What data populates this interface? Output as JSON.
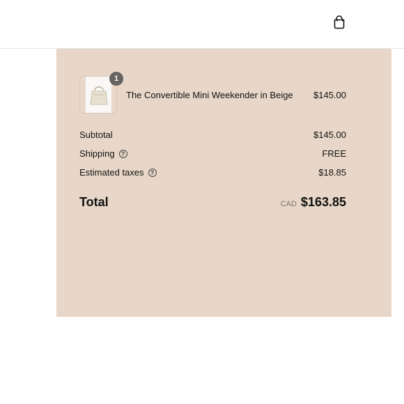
{
  "header": {
    "cart_icon": "shopping-bag-icon"
  },
  "order_summary": {
    "item": {
      "quantity": "1",
      "name": "The Convertible Mini Weekender in Beige",
      "price": "$145.00",
      "image_icon": "bag-product-image"
    },
    "lines": {
      "subtotal_label": "Subtotal",
      "subtotal_value": "$145.00",
      "shipping_label": "Shipping",
      "shipping_value": "FREE",
      "estimated_taxes_label": "Estimated taxes",
      "estimated_taxes_value": "$18.85"
    },
    "total": {
      "label": "Total",
      "currency": "CAD",
      "value": "$163.85"
    }
  },
  "colors": {
    "panel_background": "#e8d7c8",
    "badge_background": "#666361"
  }
}
